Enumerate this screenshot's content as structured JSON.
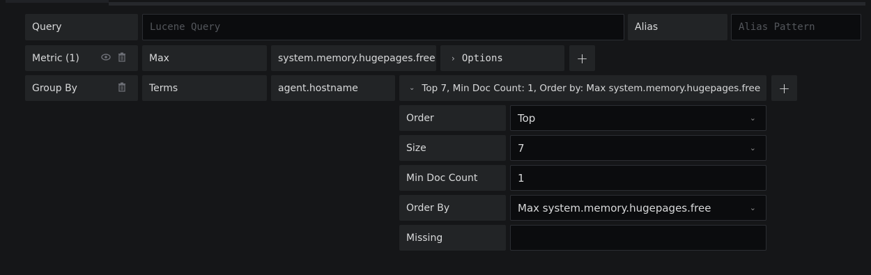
{
  "query": {
    "label": "Query",
    "placeholder": "Lucene Query",
    "alias_label": "Alias",
    "alias_placeholder": "Alias Pattern"
  },
  "metric": {
    "label": "Metric (1)",
    "icons": [
      "eye-icon",
      "trash-icon"
    ],
    "type": "Max",
    "field": "system.memory.hugepages.free",
    "options_label": "Options",
    "add": "+"
  },
  "group_by": {
    "label": "Group By",
    "type": "Terms",
    "field": "agent.hostname",
    "summary": "Top 7, Min Doc Count: 1, Order by: Max system.memory.hugepages.free",
    "add": "+",
    "settings": {
      "order_label": "Order",
      "order_value": "Top",
      "size_label": "Size",
      "size_value": "7",
      "min_doc_label": "Min Doc Count",
      "min_doc_value": "1",
      "order_by_label": "Order By",
      "order_by_value": "Max system.memory.hugepages.free",
      "missing_label": "Missing",
      "missing_value": ""
    }
  },
  "colors": {
    "background": "#151618",
    "label_bg": "#222426",
    "input_bg": "#0b0c0e",
    "border": "#2c2e33",
    "text": "#d8d9da"
  }
}
